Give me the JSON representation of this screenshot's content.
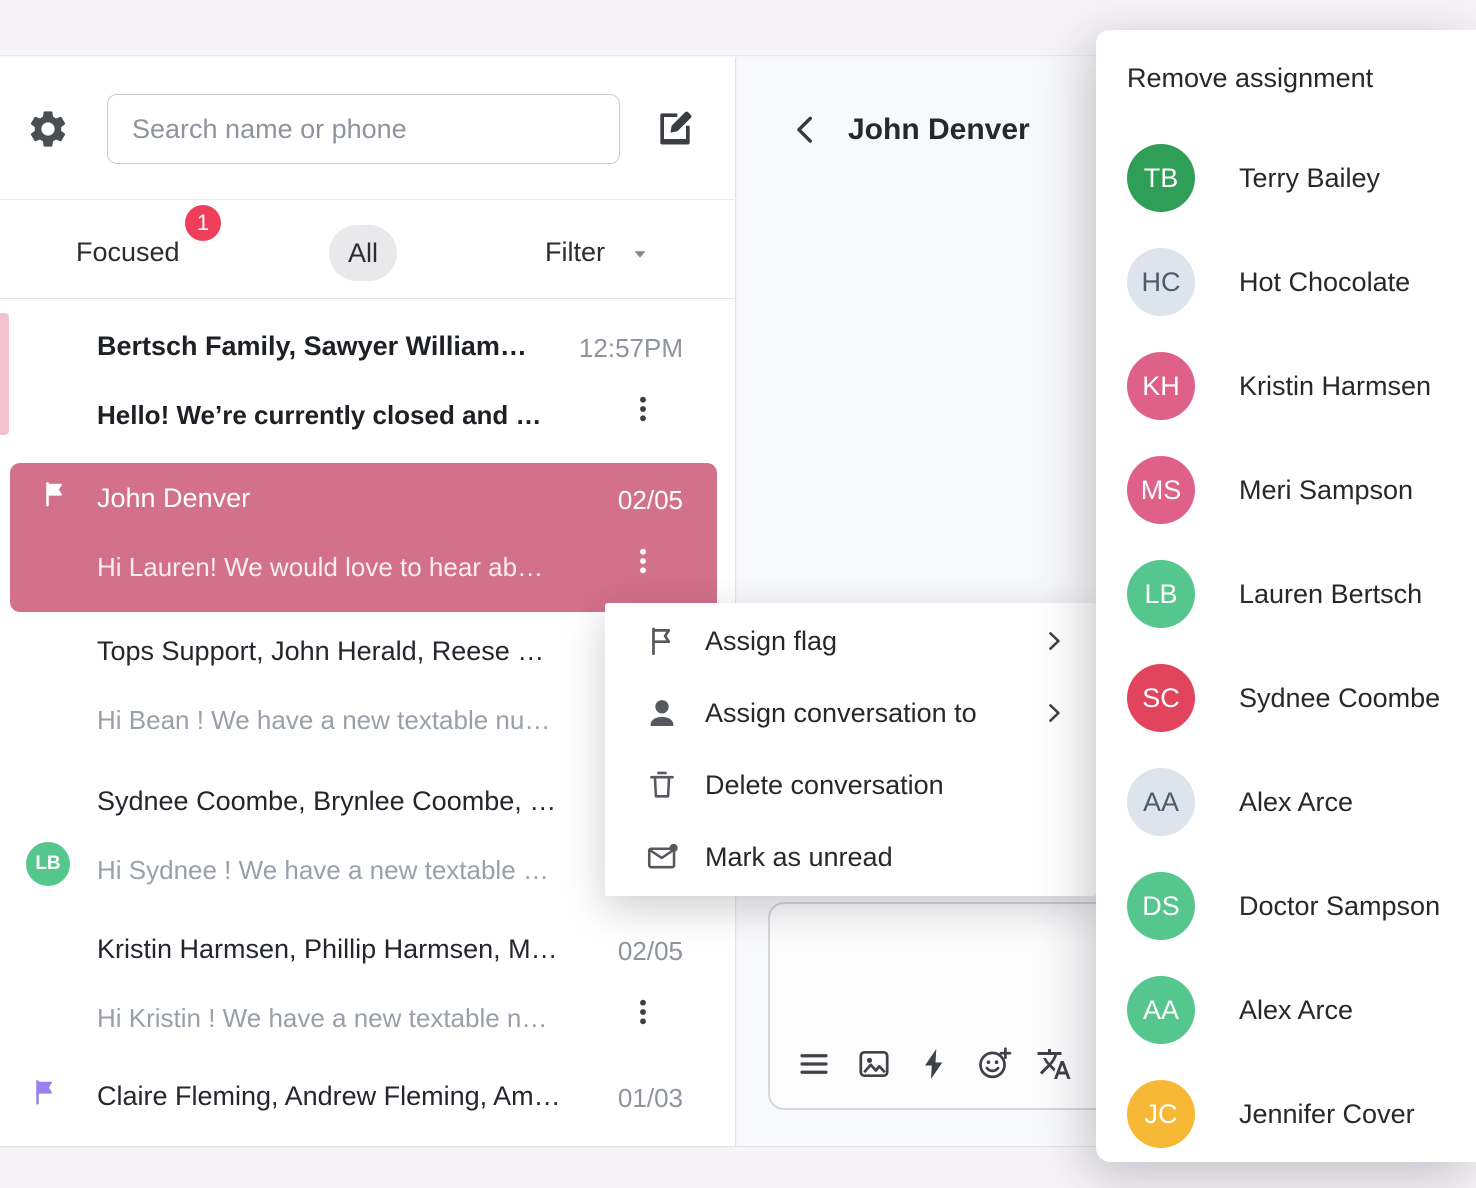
{
  "colors": {
    "selected_conversation": "#d3708a",
    "unread_accent": "#f2c3ce",
    "badge": "#ef3e5a",
    "flag_purple": "#9b7ff0",
    "mint_avatar": "#55c68e"
  },
  "sidebar": {
    "search": {
      "placeholder": "Search name or phone"
    },
    "tabs": {
      "focused": "Focused",
      "focused_badge": "1",
      "all": "All",
      "filter": "Filter"
    },
    "conversations": [
      {
        "title": "Bertsch Family, Sawyer William…",
        "time": "12:57PM",
        "preview": "Hello! We’re currently closed and …"
      },
      {
        "title": "John Denver",
        "time": "02/05",
        "preview": "Hi Lauren! We would love to hear ab…"
      },
      {
        "title": "Tops Support, John Herald, Reese Wi…",
        "preview": "Hi Bean ! We have a new textable nu…"
      },
      {
        "title": "Sydnee Coombe, Brynlee Coombe, …",
        "preview": "Hi Sydnee ! We have a new textable …",
        "avatar": "LB"
      },
      {
        "title": "Kristin Harmsen, Phillip Harmsen, Ma…",
        "time": "02/05",
        "preview": "Hi Kristin ! We have a new textable n…"
      },
      {
        "title": "Claire Fleming, Andrew Fleming, Ama…",
        "time": "01/03"
      }
    ]
  },
  "main": {
    "title": "John Denver"
  },
  "context_menu": {
    "items": [
      {
        "label": "Assign flag"
      },
      {
        "label": "Assign conversation to"
      },
      {
        "label": "Delete conversation"
      },
      {
        "label": "Mark as unread"
      }
    ]
  },
  "assign_menu": {
    "header": "Remove assignment",
    "people": [
      {
        "initials": "TB",
        "name": "Terry Bailey",
        "color": "#2f9e57",
        "text_color": "#ffffff"
      },
      {
        "initials": "HC",
        "name": "Hot Chocolate",
        "color": "#dde4ec",
        "text_color": "#4e5a6b"
      },
      {
        "initials": "KH",
        "name": "Kristin Harmsen",
        "color": "#df6189",
        "text_color": "#ffffff"
      },
      {
        "initials": "MS",
        "name": "Meri Sampson",
        "color": "#df6189",
        "text_color": "#ffffff"
      },
      {
        "initials": "LB",
        "name": "Lauren Bertsch",
        "color": "#55c68e",
        "text_color": "#ffffff"
      },
      {
        "initials": "SC",
        "name": "Sydnee Coombe",
        "color": "#e2445d",
        "text_color": "#ffffff"
      },
      {
        "initials": "AA",
        "name": "Alex Arce",
        "color": "#dde4ec",
        "text_color": "#4e5a6b"
      },
      {
        "initials": "DS",
        "name": "Doctor Sampson",
        "color": "#55c68e",
        "text_color": "#ffffff"
      },
      {
        "initials": "AA",
        "name": "Alex Arce",
        "color": "#55c68e",
        "text_color": "#ffffff"
      },
      {
        "initials": "JC",
        "name": "Jennifer Cover",
        "color": "#f7b836",
        "text_color": "#ffffff"
      }
    ]
  }
}
